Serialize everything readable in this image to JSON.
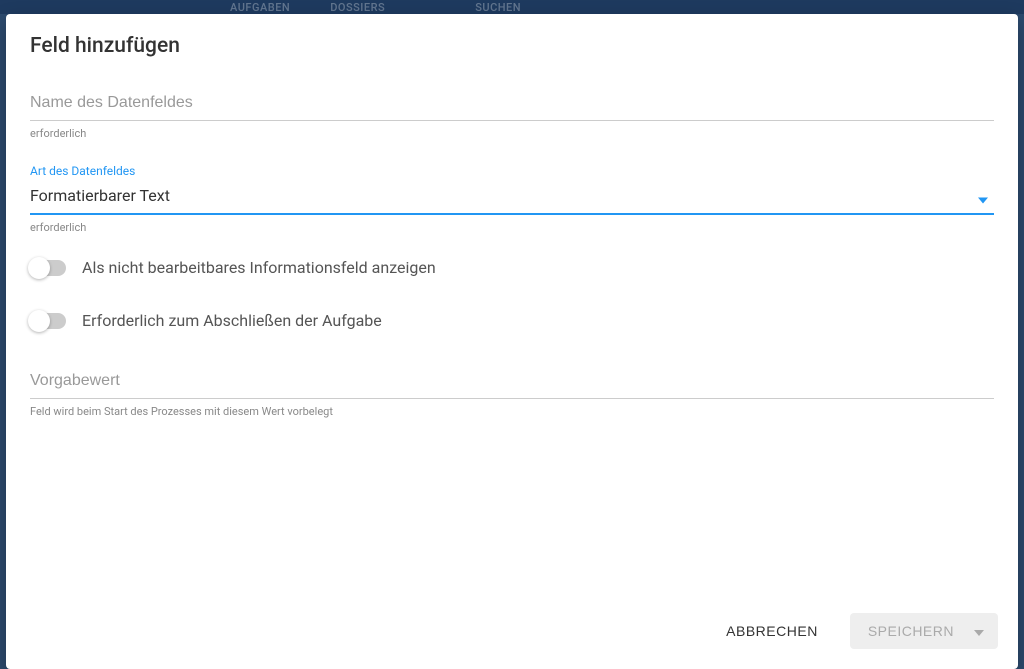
{
  "backgroundNav": {
    "item1": "AUFGABEN",
    "item2": "DOSSIERS",
    "item3": "Suchen"
  },
  "modal": {
    "title": "Feld hinzufügen"
  },
  "fields": {
    "name": {
      "placeholder": "Name des Datenfeldes",
      "helper": "erforderlich"
    },
    "type": {
      "label": "Art des Datenfeldes",
      "value": "Formatierbarer Text",
      "helper": "erforderlich"
    },
    "toggle1": {
      "label": "Als nicht bearbeitbares Informationsfeld anzeigen"
    },
    "toggle2": {
      "label": "Erforderlich zum Abschließen der Aufgabe"
    },
    "default": {
      "placeholder": "Vorgabewert",
      "helper": "Feld wird beim Start des Prozesses mit diesem Wert vorbelegt"
    }
  },
  "buttons": {
    "cancel": "ABBRECHEN",
    "save": "SPEICHERN"
  }
}
